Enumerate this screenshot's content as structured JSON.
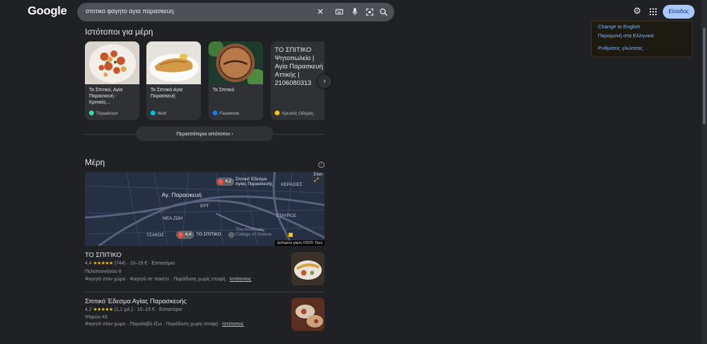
{
  "header": {
    "logo": "Google",
    "search_query": "σπιτικο φαγητο αγια παρασκευη",
    "clear_icon": "close-icon",
    "keyboard_icon": "keyboard-icon",
    "mic_icon": "mic-icon",
    "lens_icon": "lens-icon",
    "search_icon": "search-icon",
    "settings_icon": "gear-icon",
    "apps_icon": "apps-grid-icon",
    "signin_label": "Είσοδος"
  },
  "language_panel": {
    "change_english": "Change to English",
    "keep_greek": "Παραμονή στα Ελληνικά",
    "language_settings": "Ρυθμίσεις γλώσσας"
  },
  "websites": {
    "title": "Ιστότοποι για μέρη",
    "cards": [
      {
        "title": "Το Σπιτικό, Αγία Παρασκευή - Κριτικές...",
        "source": "Tripadvisor",
        "source_color": "#34e0a1"
      },
      {
        "title": "Το Σπιτικό Αγία Παρασκευή",
        "source": "Wolt",
        "source_color": "#00c2e8"
      },
      {
        "title": "Το Σπιτικό",
        "source": "Facebook",
        "source_color": "#1877f2"
      },
      {
        "title": "ΤΟ ΣΠΙΤΙΚΟ Ψητοπωλείο | Αγία Παρασκευή Αττικής | 2106080313",
        "source": "Χρυσός Οδηγός",
        "source_color": "#f4c20d"
      }
    ],
    "more_label": "Περισσότεροι ιστότοποι"
  },
  "places": {
    "title": "Μέρη",
    "map": {
      "labels": {
        "agia_paraskevi": "Αγ. Παρασκευή",
        "ert": "ΕΡΤ",
        "nea_zoi": "ΝΕΑ ΖΩΗ",
        "tsakos": "ΤΣΑΚΟΣ",
        "stavros": "ΣΤΑΥΡΟΣ",
        "kerasies": "ΚΕΡΑΣΙΕΣ",
        "american_college": "The American College of Greece",
        "edge_label": "Σταυ"
      },
      "pin1_rating": "4,2",
      "pin1_name": "Σπιτικό Έδεσμα Αγίας Παρασκευής",
      "pin2_rating": "4,4",
      "pin2_name": "ΤΟ ΣΠΙΤΙΚΟ",
      "attribution": "Δεδομένα χάρτη ©2025",
      "terms": "Όροι"
    },
    "results": [
      {
        "name": "ΤΟ ΣΠΙΤΙΚΟ",
        "rating": "4,4",
        "stars": "★★★★★",
        "reviews": "(744)",
        "price": "10–15 €",
        "category": "Εστιατόριο",
        "address": "Πελοποννήσου 8",
        "services": "Φαγητό στον χώρο · Φαγητό σε πακέτο · Παράδοση χωρίς επαφή",
        "website": "Ιστότοπος"
      },
      {
        "name": "Σπιτικό Έδεσμα Αγίας Παρασκευής",
        "rating": "4,2",
        "stars": "★★★★★",
        "reviews": "(1,1 χιλ.)",
        "price": "10–15 €",
        "category": "Εστιατόριο",
        "address": "Ψαρών 43",
        "services": "Φαγητό στον χώρο · Παραλαβή έξω · Παράδοση χωρίς επαφή",
        "website": "Ιστότοπος"
      }
    ]
  }
}
